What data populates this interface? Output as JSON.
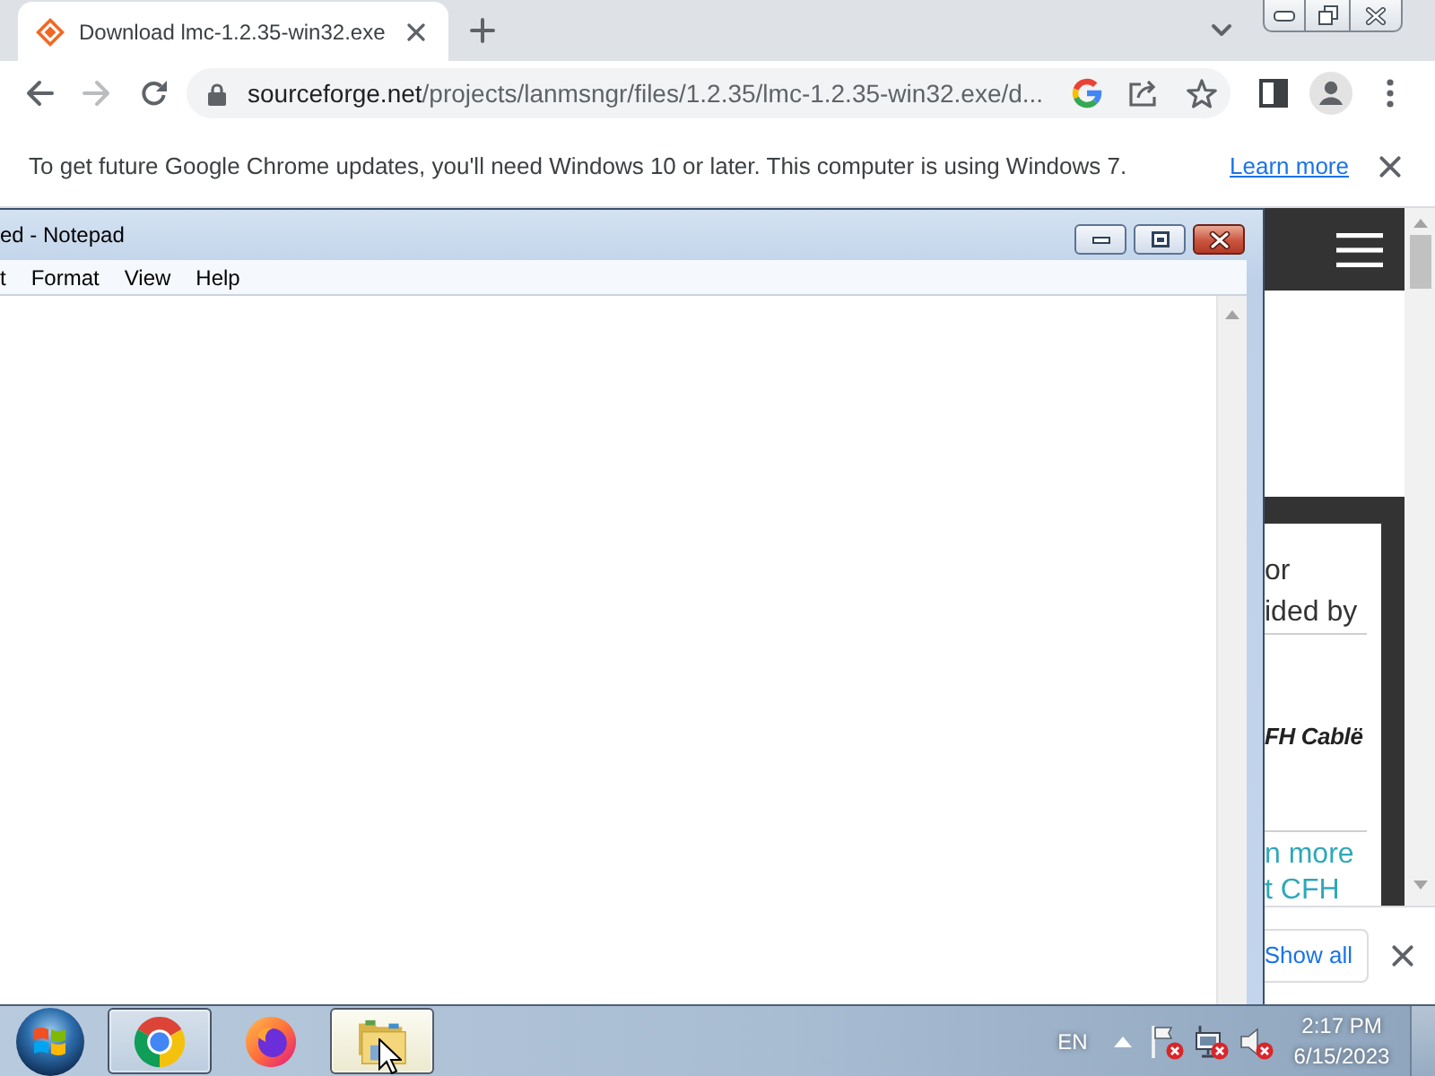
{
  "browser": {
    "tabs": [
      {
        "title": "Download lmc-1.2.35-win32.exe",
        "selected": true
      }
    ],
    "nav_buttons": [
      {
        "kind": "back",
        "disabled": false
      },
      {
        "kind": "forward",
        "disabled": true
      },
      {
        "kind": "reload",
        "disabled": false
      }
    ],
    "address_bar": {
      "url": "sourceforge.net/projects/lanmsngr/files/1.2.35/lmc-1.2.35-win32.exe/d..."
    },
    "info_bar": {
      "message": "To get future Google Chrome updates, you'll need Windows 10 or later. This computer is using Windows 7.",
      "link": "Learn more"
    },
    "page": {
      "lines": [
        "or",
        "ided by"
      ],
      "logo": "FH Cablë",
      "links": [
        "n more",
        "t CFH"
      ]
    },
    "download_bar": {
      "button": "Show all"
    }
  },
  "notepad": {
    "title": "ed - Notepad",
    "menu": [
      "t",
      "Format",
      "View",
      "Help"
    ]
  },
  "taskbar": {
    "buttons": [
      {
        "kind": "chrome",
        "running": true,
        "hovered": false
      },
      {
        "kind": "firefox",
        "running": false,
        "hovered": false
      },
      {
        "kind": "explorer",
        "running": true,
        "hovered": true
      }
    ],
    "language": "EN",
    "tray_icons": [
      {
        "kind": "flag",
        "alert": true
      },
      {
        "kind": "network",
        "alert": true
      },
      {
        "kind": "speaker",
        "alert": true
      }
    ],
    "clock": {
      "time": "2:17 PM",
      "date": "6/15/2023"
    }
  }
}
